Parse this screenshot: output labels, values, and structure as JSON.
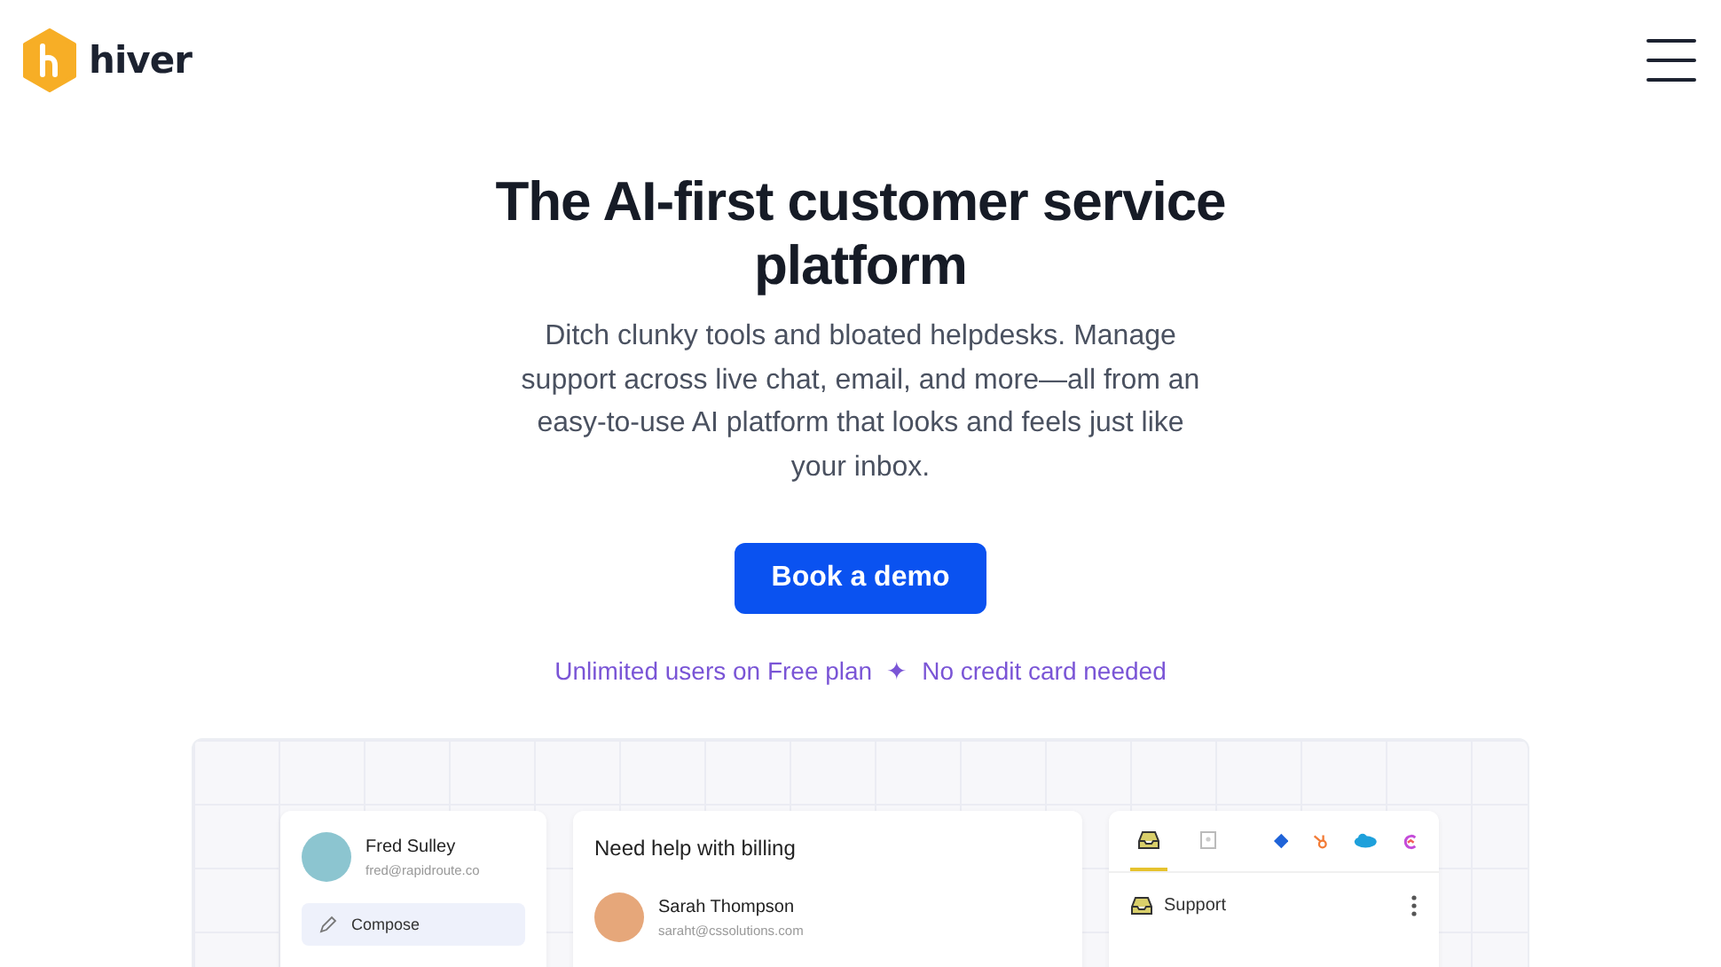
{
  "header": {
    "logo": "hiver"
  },
  "hero": {
    "title": "The AI-first customer service platform",
    "subtitle": "Ditch clunky tools and bloated helpdesks. Manage support across live chat, email, and more—all from an easy-to-use AI platform that looks and feels just like your inbox.",
    "cta": "Book a demo",
    "perks": [
      "Unlimited users on Free plan",
      "No credit card needed"
    ],
    "perk_separator": "✦"
  },
  "preview": {
    "user": {
      "name": "Fred Sulley",
      "email": "fred@rapidroute.co"
    },
    "compose": "Compose",
    "conversation": {
      "subject": "Need help with billing",
      "sender": "Sarah Thompson",
      "email": "saraht@cssolutions.com"
    },
    "tabs": [
      {
        "kind": "inbox",
        "selected": true
      },
      {
        "kind": "contact",
        "selected": false
      }
    ],
    "inbox": "Support"
  }
}
